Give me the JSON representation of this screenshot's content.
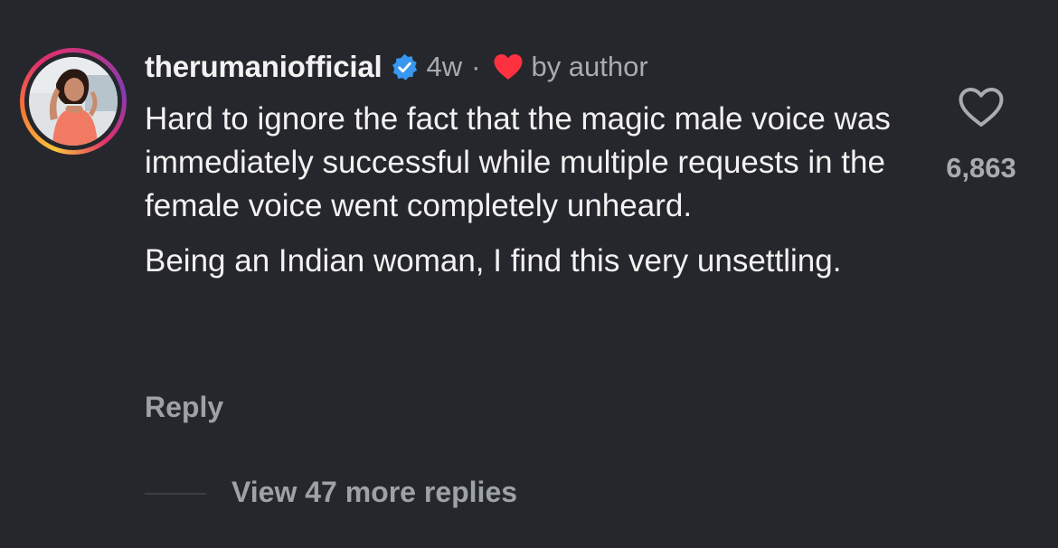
{
  "comment": {
    "username": "therumaniofficial",
    "time": "4w",
    "separator": "·",
    "author_like_label": "by author",
    "paragraphs": [
      "Hard to ignore the fact that the magic male voice was immediately successful while multiple requests in the female voice went completely unheard.",
      "Being an Indian woman, I find this very unsettling."
    ],
    "reply_label": "Reply",
    "like_count": "6,863",
    "view_more_label": "View 47 more replies",
    "icons": {
      "verified": "verified-badge-icon",
      "author_heart": "heart-filled-icon",
      "like": "heart-outline-icon"
    },
    "colors": {
      "background": "#25272c",
      "verified_blue": "#3897f0",
      "author_heart_red": "#ff3040"
    }
  }
}
